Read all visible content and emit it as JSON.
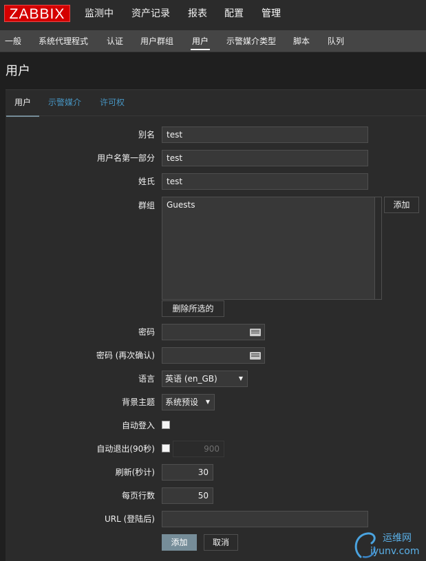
{
  "brand": {
    "logo": "ZABBIX"
  },
  "top_menu": [
    "监测中",
    "资产记录",
    "报表",
    "配置",
    "管理"
  ],
  "sub_menu": [
    "一般",
    "系统代理程式",
    "认证",
    "用户群组",
    "用户",
    "示警媒介类型",
    "脚本",
    "队列"
  ],
  "page": {
    "title": "用户"
  },
  "tabs": [
    "用户",
    "示警媒介",
    "许可权"
  ],
  "form": {
    "alias": {
      "label": "别名",
      "value": "test"
    },
    "name": {
      "label": "用户名第一部分",
      "value": "test"
    },
    "surname": {
      "label": "姓氏",
      "value": "test"
    },
    "groups": {
      "label": "群组",
      "items": [
        "Guests"
      ],
      "add_label": "添加",
      "delete_label": "删除所选的"
    },
    "password": {
      "label": "密码"
    },
    "password_confirm": {
      "label": "密码 (再次确认)"
    },
    "language": {
      "label": "语言",
      "value": "英语 (en_GB)"
    },
    "theme": {
      "label": "背景主题",
      "value": "系统预设"
    },
    "autologin": {
      "label": "自动登入",
      "checked": false
    },
    "autologout": {
      "label": "自动退出(90秒)",
      "checked": false,
      "value": "900"
    },
    "refresh": {
      "label": "刷新(秒计)",
      "value": "30"
    },
    "rows_per_page": {
      "label": "每页行数",
      "value": "50"
    },
    "url": {
      "label": "URL (登陆后)",
      "value": ""
    }
  },
  "actions": {
    "add_label": "添加",
    "cancel_label": "取消"
  },
  "watermark": {
    "title": "运维网",
    "subtitle": "iyunv.com"
  },
  "colors": {
    "logo_red": "#d40000",
    "link_blue": "#4796c4",
    "primary_button": "#768d99"
  }
}
